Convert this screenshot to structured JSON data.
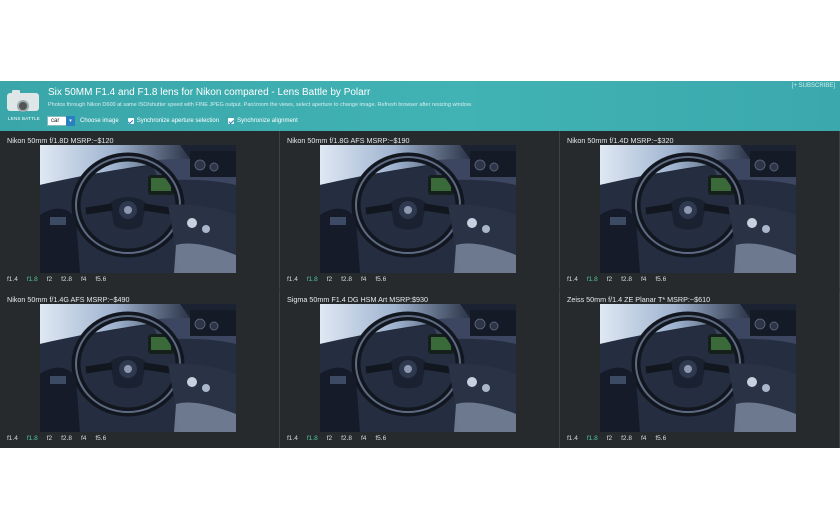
{
  "header": {
    "logo_label": "LENS BATTLE",
    "title": "Six 50MM F1.4 and F1.8 lens for Nikon compared - Lens Battle by Polarr",
    "subtitle": "Photos through Nikon D600 at same ISO/shutter speed with FINE JPEG output. Pan/zoom the views, select aperture to change image. Refresh browser after resizing window.",
    "subscribe": "[+ SUBSCRIBE]",
    "image_select": {
      "value": "car"
    },
    "choose_image_label": "Choose image",
    "sync_aperture_label": "Synchronize aperture selection",
    "sync_alignment_label": "Synchronize alignment"
  },
  "apertures": [
    "f1.4",
    "f1.8",
    "f2",
    "f2.8",
    "f4",
    "f5.6"
  ],
  "selected_aperture": "f1.8",
  "lenses": [
    {
      "title": "Nikon 50mm f/1.8D MSRP:~$120"
    },
    {
      "title": "Nikon 50mm f/1.8G AFS MSRP:~$190"
    },
    {
      "title": "Nikon 50mm f/1.4D MSRP:~$320"
    },
    {
      "title": "Nikon 50mm f/1.4G AFS MSRP:~$490"
    },
    {
      "title": "Sigma 50mm F1.4 DG HSM Art MSRP:$930"
    },
    {
      "title": "Zeiss 50mm f/1.4 ZE Planar T* MSRP:~$610"
    }
  ],
  "colors": {
    "header_bg": "#41b3b4",
    "app_bg": "#262a2c",
    "active_stop": "#52c79a",
    "checkbox_accent": "#2a7fc0"
  },
  "icons": {
    "logo": "camera-icon",
    "checkbox": "checkbox-checked-icon",
    "select": "chevron-down-icon"
  }
}
